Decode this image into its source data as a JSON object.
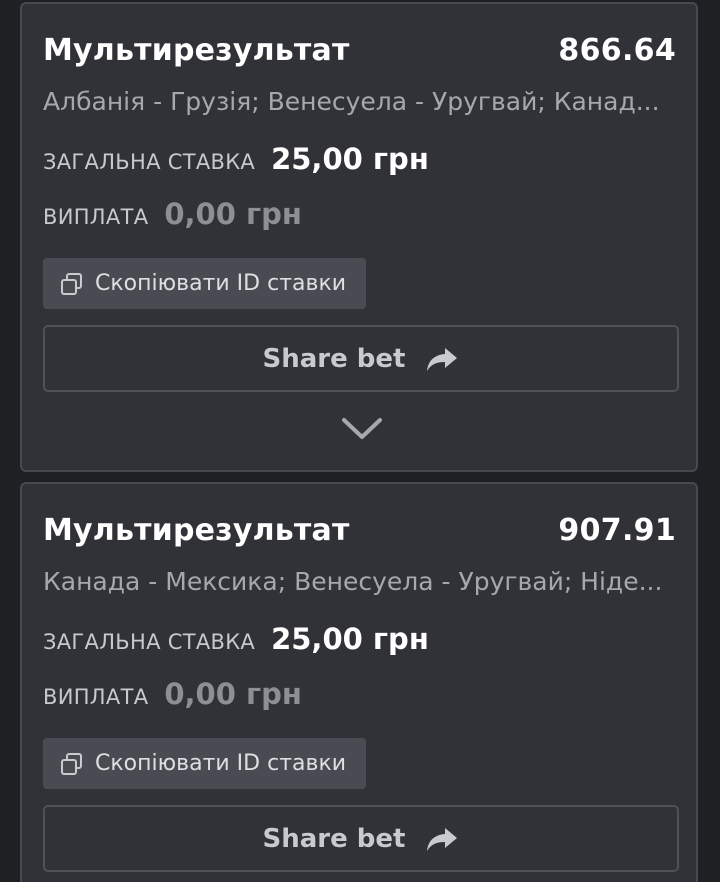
{
  "bets": [
    {
      "title": "Мультирезультат",
      "odds": "866.64",
      "events": "Албанія - Грузія; Венесуела - Уругвай; Канад...",
      "stake_label": "ЗАГАЛЬНА СТАВКА",
      "stake_value": "25,00 грн",
      "payout_label": "ВИПЛАТА",
      "payout_value": "0,00 грн",
      "copy_label": "Скопіювати ID ставки",
      "share_label": "Share bet"
    },
    {
      "title": "Мультирезультат",
      "odds": "907.91",
      "events": "Канада - Мексика; Венесуела - Уругвай; Ніде...",
      "stake_label": "ЗАГАЛЬНА СТАВКА",
      "stake_value": "25,00 грн",
      "payout_label": "ВИПЛАТА",
      "payout_value": "0,00 грн",
      "copy_label": "Скопіювати ID ставки",
      "share_label": "Share bet"
    }
  ],
  "icons": {
    "copy": "copy-icon",
    "share": "share-arrow-icon",
    "expand": "chevron-down-icon"
  },
  "colors": {
    "background": "#1f2024",
    "card": "#313238",
    "card_border": "#474850",
    "muted_text": "#a7a8ae",
    "payout_text": "#8e8f95"
  }
}
